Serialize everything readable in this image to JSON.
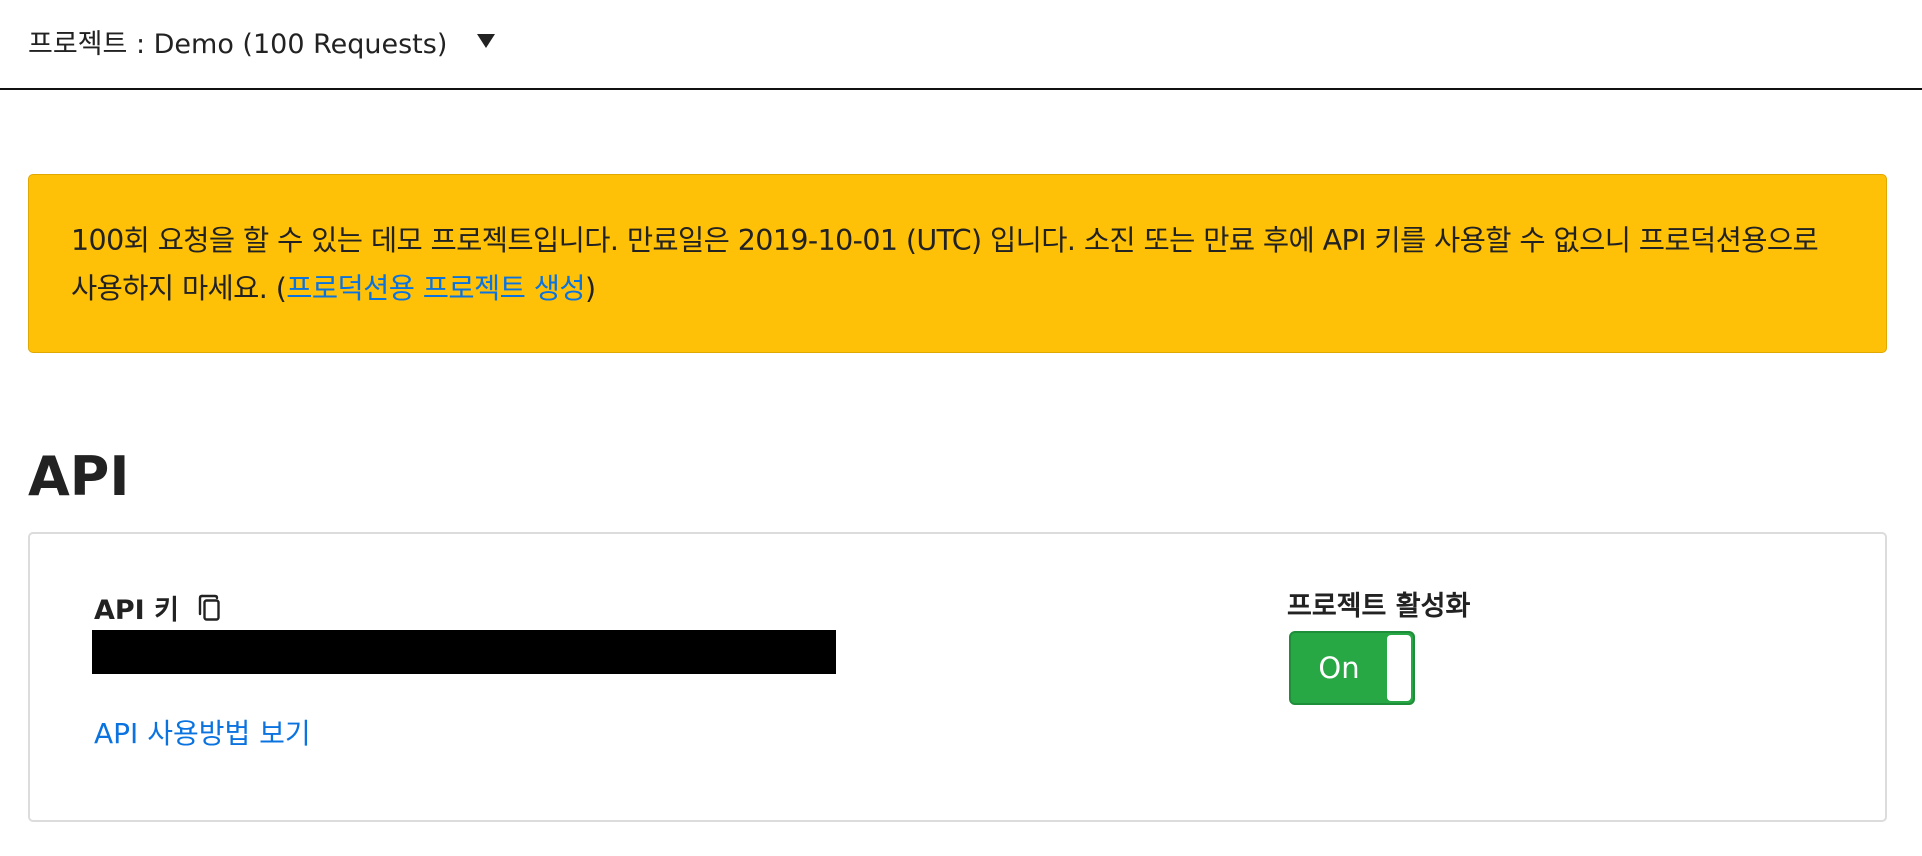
{
  "header": {
    "project_label": "프로젝트 : Demo (100 Requests)"
  },
  "alert": {
    "message": "100회 요청을 할 수 있는 데모 프로젝트입니다. 만료일은 2019-10-01 (UTC) 입니다. 소진 또는 만료 후에 API 키를 사용할 수 없으니 프로덕션용으로 사용하지 마세요. (",
    "link_text": "프로덕션용 프로젝트 생성",
    "suffix": ")"
  },
  "section": {
    "title": "API"
  },
  "card": {
    "key_label": "API 키",
    "usage_link": "API 사용방법 보기",
    "activation_label": "프로젝트 활성화",
    "toggle_text": "On",
    "toggle_state": true
  },
  "icons": {
    "copy": "copy-icon",
    "dropdown": "caret-down-icon"
  },
  "colors": {
    "alert_background": "#ffc107",
    "link": "#0b73e0",
    "toggle_on": "#28a745"
  }
}
